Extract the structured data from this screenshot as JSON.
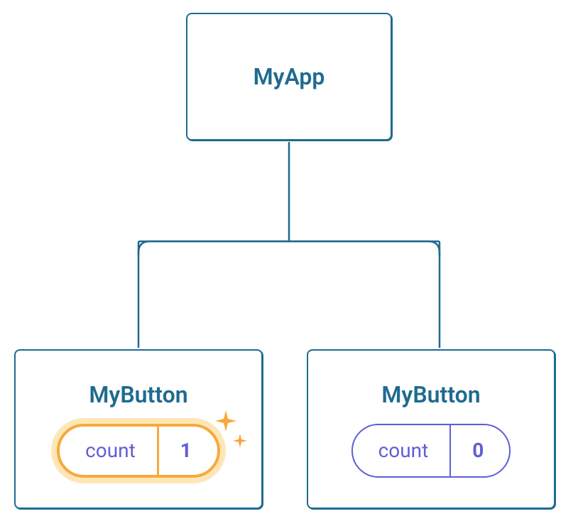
{
  "tree": {
    "root": {
      "label": "MyApp"
    },
    "children": [
      {
        "label": "MyButton",
        "pill": {
          "label": "count",
          "value": "1",
          "highlighted": true
        }
      },
      {
        "label": "MyButton",
        "pill": {
          "label": "count",
          "value": "0",
          "highlighted": false
        }
      }
    ]
  },
  "icons": {
    "sparkle": "sparkle-icon"
  },
  "colors": {
    "nodeBorder": "#1e6b8f",
    "nodeText": "#1e6b8f",
    "pillBorder": "#5f5ed7",
    "pillText": "#5f5ed7",
    "highlightBorder": "#f7a93b",
    "highlightGlow": "#fdd47b"
  }
}
